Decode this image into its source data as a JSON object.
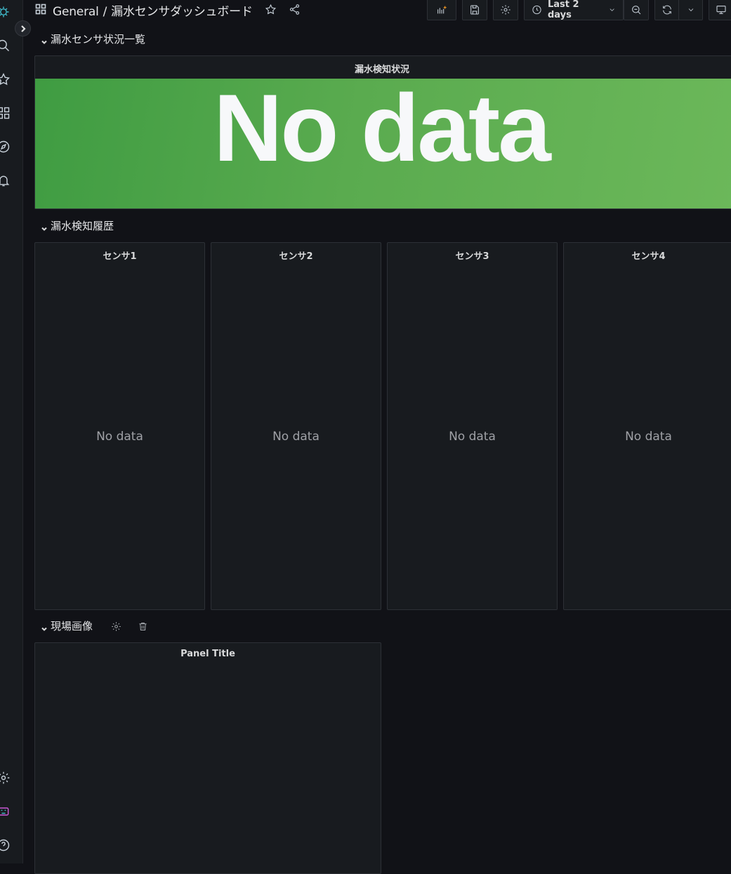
{
  "breadcrumb": {
    "folder": "General",
    "separator": "/",
    "dashboard": "漏水センサダッシュボード"
  },
  "toolbar": {
    "time_range": "Last 2 days"
  },
  "rows": [
    {
      "title": "漏水センサ状況一覧"
    },
    {
      "title": "漏水検知履歴"
    },
    {
      "title": "現場画像"
    }
  ],
  "stat_panel": {
    "title": "漏水検知状況",
    "value": "No data",
    "color": "#56a64b"
  },
  "sensor_panels": [
    {
      "title": "センサ1",
      "message": "No data"
    },
    {
      "title": "センサ2",
      "message": "No data"
    },
    {
      "title": "センサ3",
      "message": "No data"
    },
    {
      "title": "センサ4",
      "message": "No data"
    }
  ],
  "image_panel": {
    "title": "Panel Title"
  }
}
